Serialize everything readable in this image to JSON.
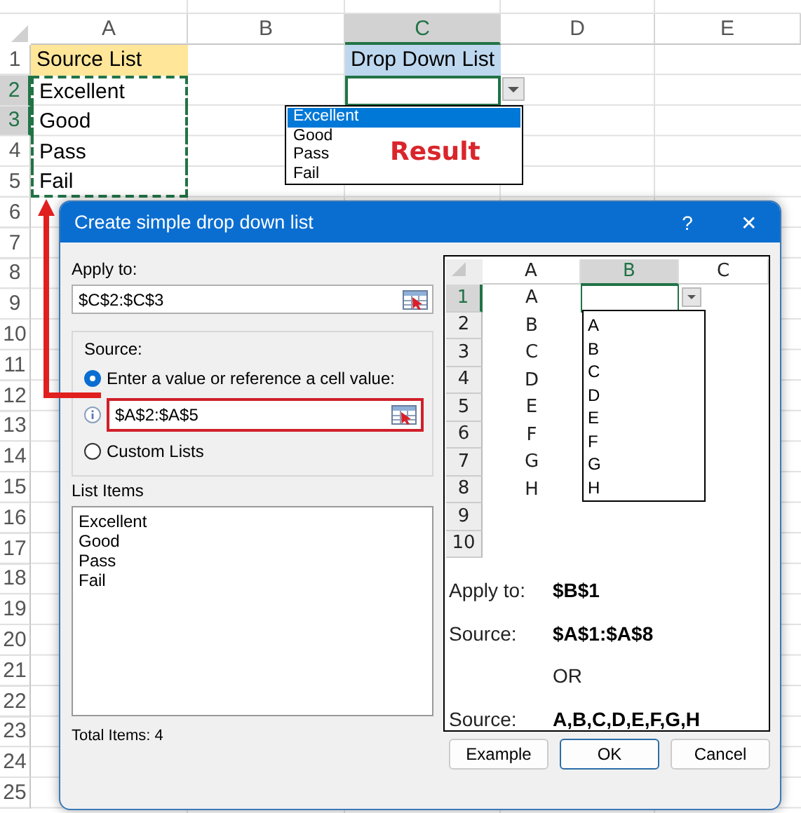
{
  "sheet": {
    "columns": [
      {
        "label": "A",
        "selected": false
      },
      {
        "label": "B",
        "selected": false
      },
      {
        "label": "C",
        "selected": true
      },
      {
        "label": "D",
        "selected": false
      },
      {
        "label": "E",
        "selected": false
      }
    ],
    "rows": [
      {
        "number": "1",
        "selected": false,
        "cells": [
          {
            "text": "Source List",
            "kind": "source-header"
          },
          null,
          {
            "text": "Drop Down List",
            "kind": "list-header"
          },
          null,
          null
        ]
      },
      {
        "number": "2",
        "selected": true,
        "cells": [
          {
            "text": "Excellent",
            "copied": true
          },
          null,
          {
            "active": true
          },
          null,
          null
        ]
      },
      {
        "number": "3",
        "selected": true,
        "cells": [
          {
            "text": "Good",
            "copied": true
          },
          null,
          null,
          null,
          null
        ]
      },
      {
        "number": "4",
        "selected": false,
        "cells": [
          {
            "text": "Pass",
            "copied": true
          },
          null,
          null,
          null,
          null
        ]
      },
      {
        "number": "5",
        "selected": false,
        "cells": [
          {
            "text": "Fail",
            "copied": true
          },
          null,
          null,
          null,
          null
        ]
      },
      {
        "number": "6",
        "selected": false
      },
      {
        "number": "7",
        "selected": false
      },
      {
        "number": "8",
        "selected": false
      },
      {
        "number": "9",
        "selected": false
      },
      {
        "number": "10",
        "selected": false
      },
      {
        "number": "11",
        "selected": false
      },
      {
        "number": "12",
        "selected": false
      },
      {
        "number": "13",
        "selected": false
      },
      {
        "number": "14",
        "selected": false
      },
      {
        "number": "15",
        "selected": false
      },
      {
        "number": "16",
        "selected": false
      },
      {
        "number": "17",
        "selected": false
      },
      {
        "number": "18",
        "selected": false
      },
      {
        "number": "19",
        "selected": false
      },
      {
        "number": "20",
        "selected": false
      },
      {
        "number": "21",
        "selected": false
      },
      {
        "number": "22",
        "selected": false
      },
      {
        "number": "23",
        "selected": false
      },
      {
        "number": "24",
        "selected": false
      },
      {
        "number": "25",
        "selected": false
      }
    ]
  },
  "dropdown": {
    "items": [
      {
        "label": "Excellent",
        "selected": true
      },
      {
        "label": "Good",
        "selected": false
      },
      {
        "label": "Pass",
        "selected": false
      },
      {
        "label": "Fail",
        "selected": false
      }
    ],
    "annotation": "Result"
  },
  "dialog": {
    "title": "Create simple drop down list",
    "help": "?",
    "close": "✕",
    "apply_to": {
      "label": "Apply to:",
      "value": "$C$2:$C$3"
    },
    "source": {
      "legend": "Source:",
      "options": [
        {
          "label": "Enter a value or reference a cell value:",
          "selected": true
        },
        {
          "label": "Custom Lists",
          "selected": false
        }
      ],
      "value": "$A$2:$A$5",
      "highlighted": true
    },
    "list_items": {
      "label": "List Items",
      "items": [
        "Excellent",
        "Good",
        "Pass",
        "Fail"
      ],
      "total": "Total Items: 4"
    },
    "preview": {
      "columns": [
        {
          "label": "A",
          "selected": false
        },
        {
          "label": "B",
          "selected": true
        },
        {
          "label": "C",
          "selected": false
        }
      ],
      "rows": [
        {
          "number": "1",
          "selected": true,
          "value": "A"
        },
        {
          "number": "2",
          "selected": false,
          "value": "B"
        },
        {
          "number": "3",
          "selected": false,
          "value": "C"
        },
        {
          "number": "4",
          "selected": false,
          "value": "D"
        },
        {
          "number": "5",
          "selected": false,
          "value": "E"
        },
        {
          "number": "6",
          "selected": false,
          "value": "F"
        },
        {
          "number": "7",
          "selected": false,
          "value": "G"
        },
        {
          "number": "8",
          "selected": false,
          "value": "H"
        },
        {
          "number": "9",
          "selected": false
        },
        {
          "number": "10",
          "selected": false
        }
      ],
      "dropdown_items": [
        "A",
        "B",
        "C",
        "D",
        "E",
        "F",
        "G",
        "H"
      ],
      "notes": [
        {
          "label": "Apply to:",
          "value": "$B$1"
        },
        {
          "label": "Source:",
          "value": "$A$1:$A$8"
        },
        {
          "value": "OR"
        },
        {
          "label": "Source:",
          "value": "A,B,C,D,E,F,G,H"
        }
      ]
    },
    "buttons": [
      {
        "label": "Example",
        "default": false
      },
      {
        "label": "OK",
        "default": true
      },
      {
        "label": "Cancel",
        "default": false
      }
    ]
  }
}
